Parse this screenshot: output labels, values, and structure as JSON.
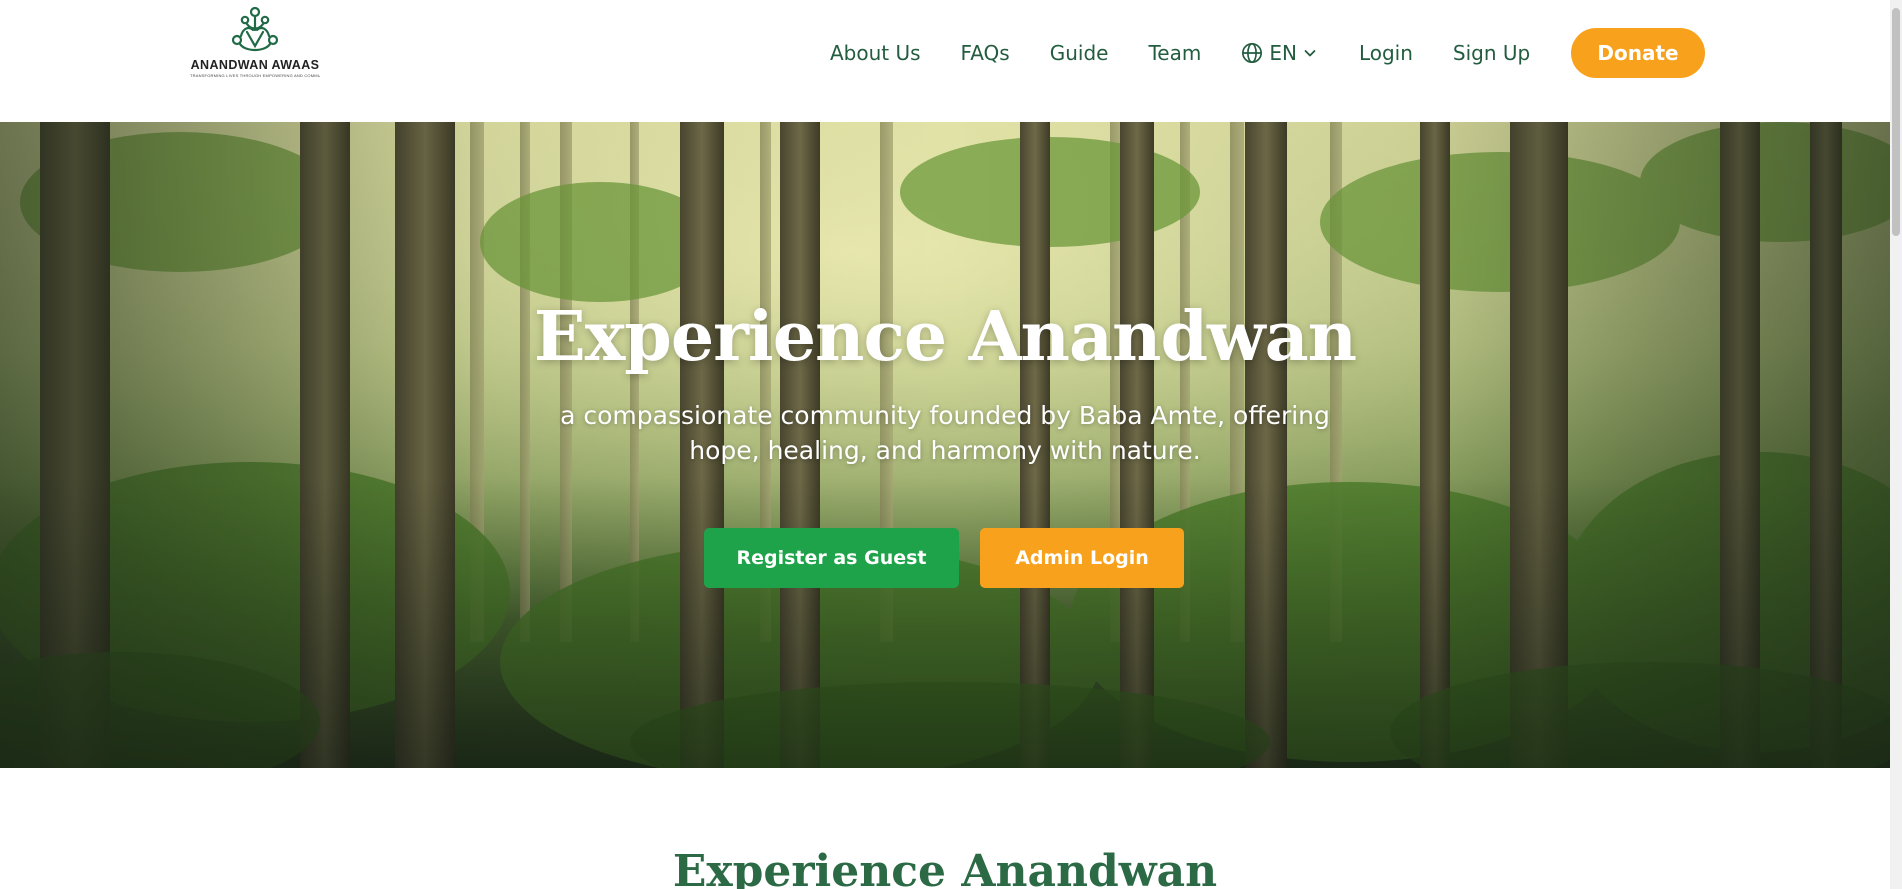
{
  "brand": {
    "name": "ANANDWAN AWAAS",
    "tagline": "TRANSFORMING LIVES THROUGH EMPOWERING AND COMMUNITY",
    "logo_icon": "people-circle-logo",
    "primary_color": "#235c3f"
  },
  "nav": {
    "links": [
      "About Us",
      "FAQs",
      "Guide",
      "Team"
    ],
    "language": {
      "icon": "globe-icon",
      "label": "EN",
      "chevron": "chevron-down-icon"
    },
    "login": "Login",
    "signup": "Sign Up",
    "donate": "Donate",
    "donate_color": "#f8a11c"
  },
  "hero": {
    "title": "Experience Anandwan",
    "subtitle_line1": "a compassionate community founded by Baba Amte, offering",
    "subtitle_line2": "hope, healing, and harmony with nature.",
    "register_button": "Register as Guest",
    "register_color": "#1fa34a",
    "admin_button": "Admin Login",
    "admin_color": "#f8a11c"
  },
  "section": {
    "title": "Experience Anandwan",
    "title_color": "#2b6a45"
  }
}
